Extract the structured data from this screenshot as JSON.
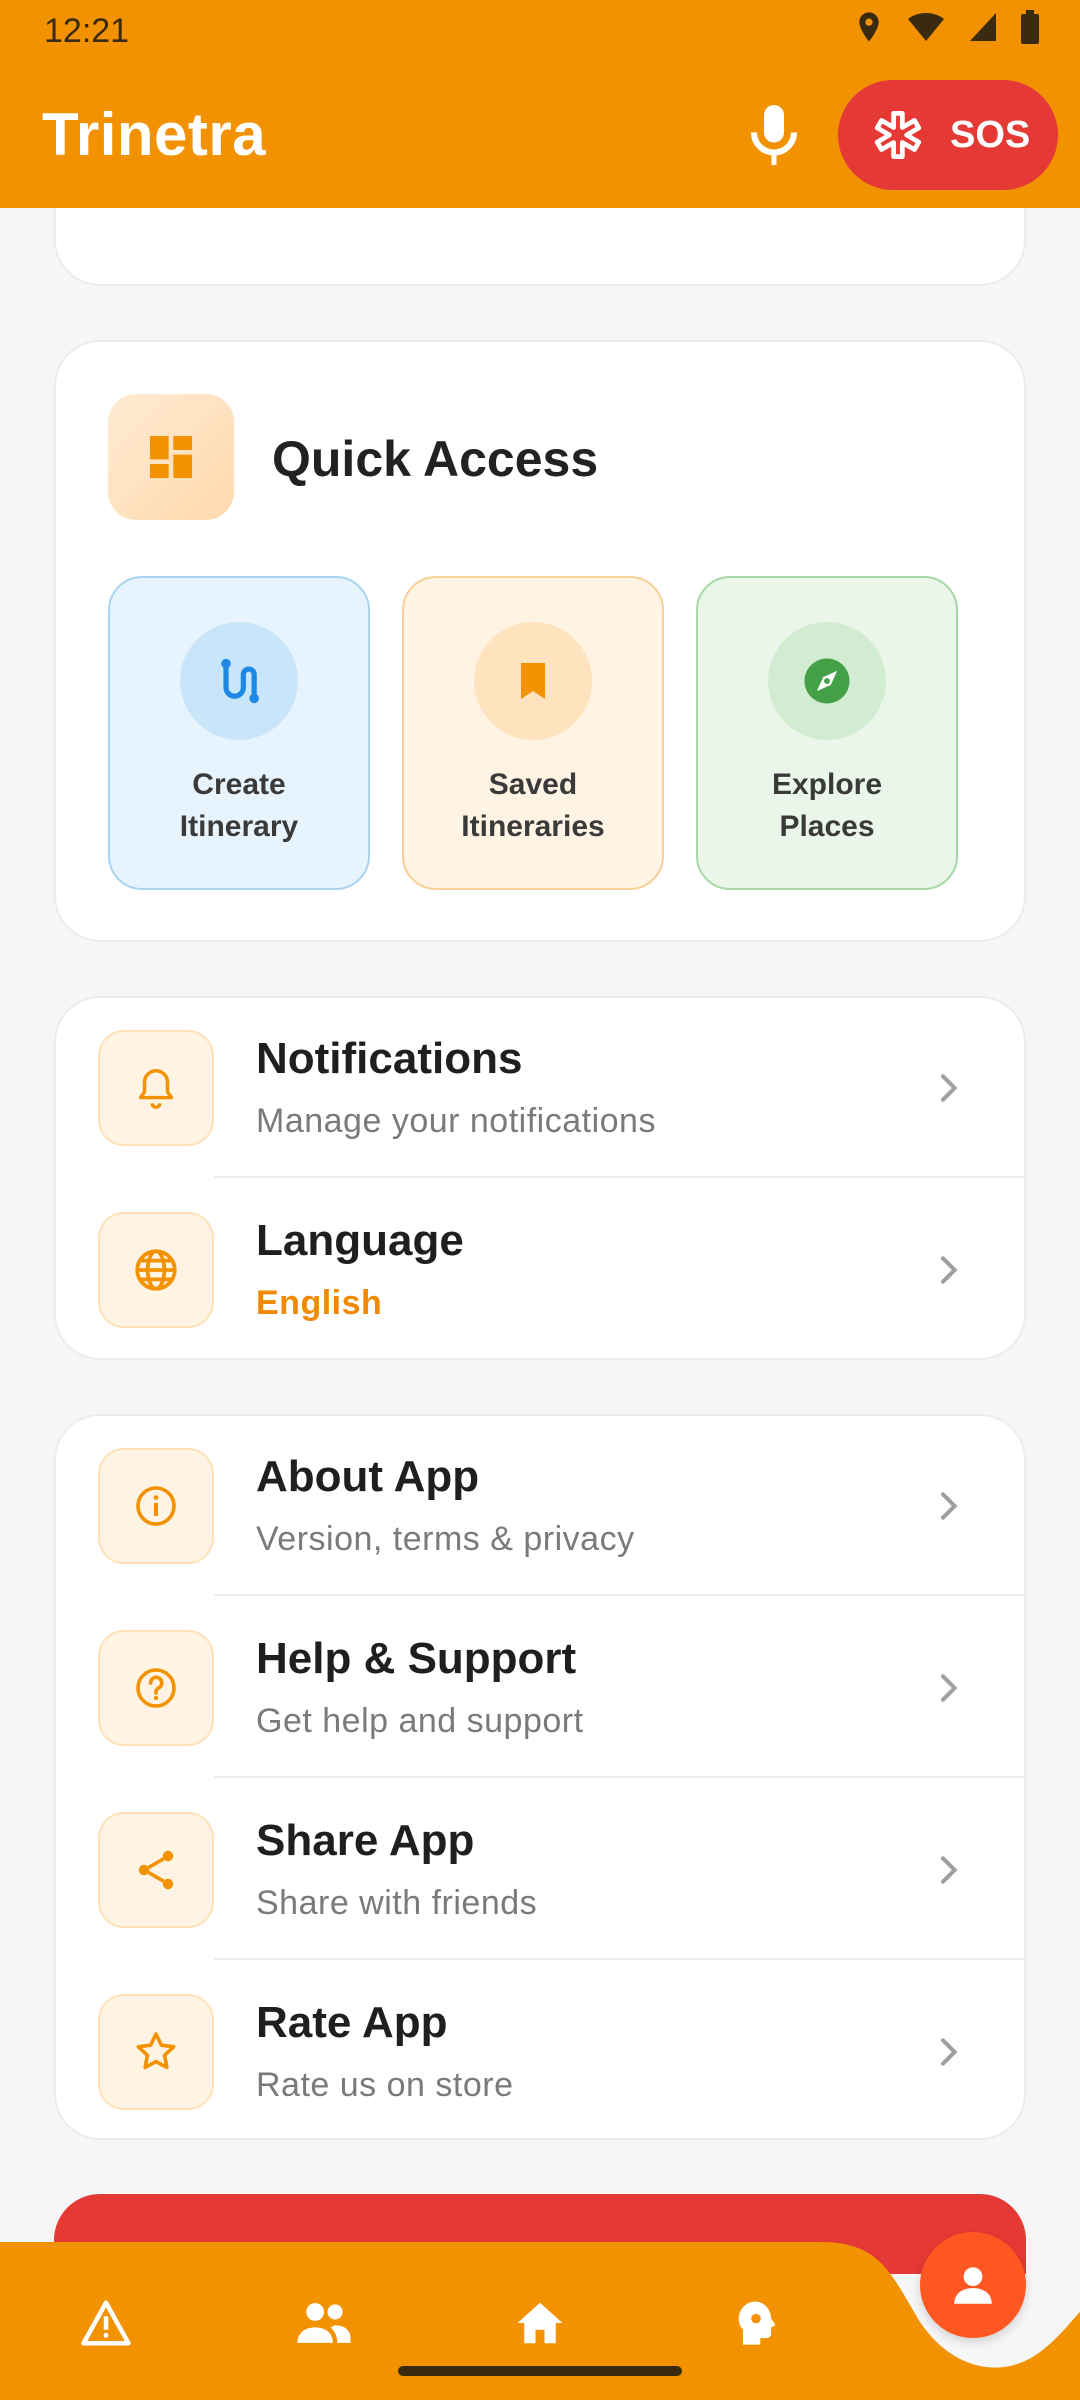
{
  "status_bar": {
    "time": "12:21",
    "icons": [
      "location-icon",
      "wifi-icon",
      "signal-icon",
      "battery-icon"
    ]
  },
  "header": {
    "title": "Trinetra",
    "mic_icon": "mic-icon",
    "sos_label": "SOS",
    "sos_icon": "medical-star-icon"
  },
  "quick_access": {
    "title": "Quick Access",
    "icon": "dashboard-icon",
    "tiles": [
      {
        "line1": "Create",
        "line2": "Itinerary",
        "icon": "route-icon",
        "color": "#1E88E5"
      },
      {
        "line1": "Saved",
        "line2": "Itineraries",
        "icon": "bookmark-icon",
        "color": "#F39200"
      },
      {
        "line1": "Explore",
        "line2": "Places",
        "icon": "compass-icon",
        "color": "#43A047"
      }
    ]
  },
  "settings": [
    {
      "title": "Notifications",
      "subtitle": "Manage your notifications",
      "icon": "bell-icon"
    },
    {
      "title": "Language",
      "subtitle": "English",
      "icon": "globe-icon"
    }
  ],
  "more": [
    {
      "title": "About App",
      "subtitle": "Version, terms & privacy",
      "icon": "info-icon"
    },
    {
      "title": "Help & Support",
      "subtitle": "Get help and support",
      "icon": "help-icon"
    },
    {
      "title": "Share App",
      "subtitle": "Share with friends",
      "icon": "share-icon"
    },
    {
      "title": "Rate App",
      "subtitle": "Rate us on store",
      "icon": "star-icon"
    }
  ],
  "bottom_nav": [
    "alert-icon",
    "people-icon",
    "home-icon",
    "guide-icon",
    "profile-icon"
  ],
  "colors": {
    "primary": "#F39200",
    "danger": "#E53935",
    "accent_text": "#EF8A00",
    "fab": "#FF5722"
  }
}
